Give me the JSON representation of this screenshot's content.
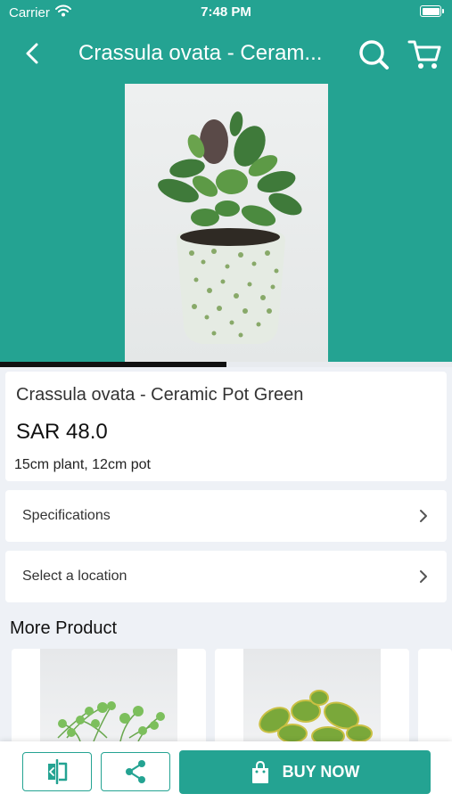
{
  "status_bar": {
    "carrier": "Carrier",
    "time": "7:48 PM"
  },
  "nav": {
    "title": "Crassula ovata - Ceram..."
  },
  "gallery": {
    "progress": 0.5
  },
  "product": {
    "name": "Crassula ovata - Ceramic Pot Green",
    "price": "SAR 48.0",
    "size": "15cm plant, 12cm pot"
  },
  "rows": {
    "specifications": "Specifications",
    "location": "Select a location"
  },
  "more": {
    "title": "More Product"
  },
  "actions": {
    "buy_now": "BUY NOW"
  },
  "colors": {
    "accent": "#24a392"
  },
  "icons": [
    "wifi-icon",
    "battery-icon",
    "back-icon",
    "search-icon",
    "cart-icon",
    "chevron-right-icon",
    "compare-icon",
    "share-icon",
    "shopping-bag-icon"
  ]
}
